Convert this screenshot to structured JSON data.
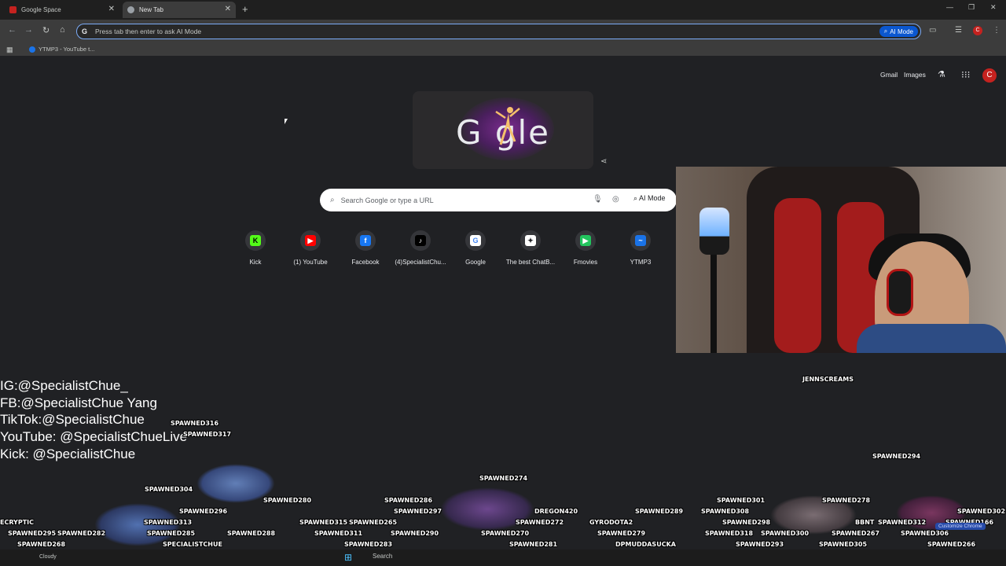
{
  "browser": {
    "tabs": [
      {
        "title": "Google Space",
        "favicon_color": "#c5221f"
      },
      {
        "title": "New Tab",
        "favicon_color": "#9aa0a6"
      }
    ],
    "new_tab_icon": "plus-icon",
    "omnibox": {
      "g_label": "G",
      "placeholder": "Press tab then enter to ask AI Mode",
      "ai_mode_label": "AI Mode"
    },
    "profile_letter": "C",
    "bookmarks": [
      {
        "label": "YTMP3 - YouTube t..."
      }
    ]
  },
  "newtab": {
    "header_links": [
      "Gmail",
      "Images"
    ],
    "account_letter": "C",
    "doodle_text": "G    gle",
    "search": {
      "placeholder": "Search Google or type a URL",
      "ai_mode_label": "AI Mode"
    },
    "shortcuts": [
      {
        "label": "Kick",
        "icon": "K",
        "color": "#53fc18",
        "text_color": "#000000"
      },
      {
        "label": "(1) YouTube",
        "icon": "▶",
        "color": "#ff0000",
        "text_color": "#ffffff"
      },
      {
        "label": "Facebook",
        "icon": "f",
        "color": "#1877f2",
        "text_color": "#ffffff"
      },
      {
        "label": "(4)SpecialistChu...",
        "icon": "♪",
        "color": "#000000",
        "text_color": "#ffffff"
      },
      {
        "label": "Google",
        "icon": "G",
        "color": "#ffffff",
        "text_color": "#4285f4"
      },
      {
        "label": "The best ChatB...",
        "icon": "✦",
        "color": "#ffffff",
        "text_color": "#202124"
      },
      {
        "label": "Fmovies",
        "icon": "▶",
        "color": "#22c55e",
        "text_color": "#ffffff"
      },
      {
        "label": "YTMP3",
        "icon": "~",
        "color": "#1a73e8",
        "text_color": "#ffffff"
      }
    ]
  },
  "stream_overlay": {
    "socials": [
      "IG:@SpecialistChue_",
      "FB:@SpecialistChue Yang",
      "TikTok:@SpecialistChue",
      "YouTube: @SpecialistChueLive",
      "Kick: @SpecialistChue"
    ],
    "spawn_labels": [
      "SPAWNED316",
      "SPAWNED317",
      "JENNSCREAMS",
      "SPAWNED294",
      "SPAWNED274",
      "SPAWNED304",
      "SPAWNED280",
      "SPAWNED286",
      "SPAWNED301",
      "SPAWNED278",
      "SPAWNED296",
      "SPAWNED297",
      "DREGON420",
      "SPAWNED289",
      "SPAWNED308",
      "SPAWNED302",
      "ECRYPTIC",
      "SPAWNED313",
      "SPAWNED315",
      "SPAWNED265",
      "SPAWNED272",
      "GYRODOTA2",
      "SPAWNED298",
      "BBNT",
      "SPAWNED312",
      "SPAWNED166",
      "SPAWNED295",
      "SPAWNED282",
      "SPAWNED285",
      "SPAWNED288",
      "SPAWNED311",
      "SPAWNED290",
      "SPAWNED270",
      "SPAWNED279",
      "SPAWNED318",
      "SPAWNED300",
      "SPAWNED267",
      "SPAWNED306",
      "SPAWNED268",
      "SPECIALISTCHUE",
      "SPAWNED283",
      "SPAWNED281",
      "DPMUDDASUCKA",
      "SPAWNED293",
      "SPAWNED305",
      "SPAWNED266"
    ]
  },
  "taskbar": {
    "weather": "Cloudy",
    "search_label": "Search",
    "tooltip": "Customize Chrome"
  }
}
